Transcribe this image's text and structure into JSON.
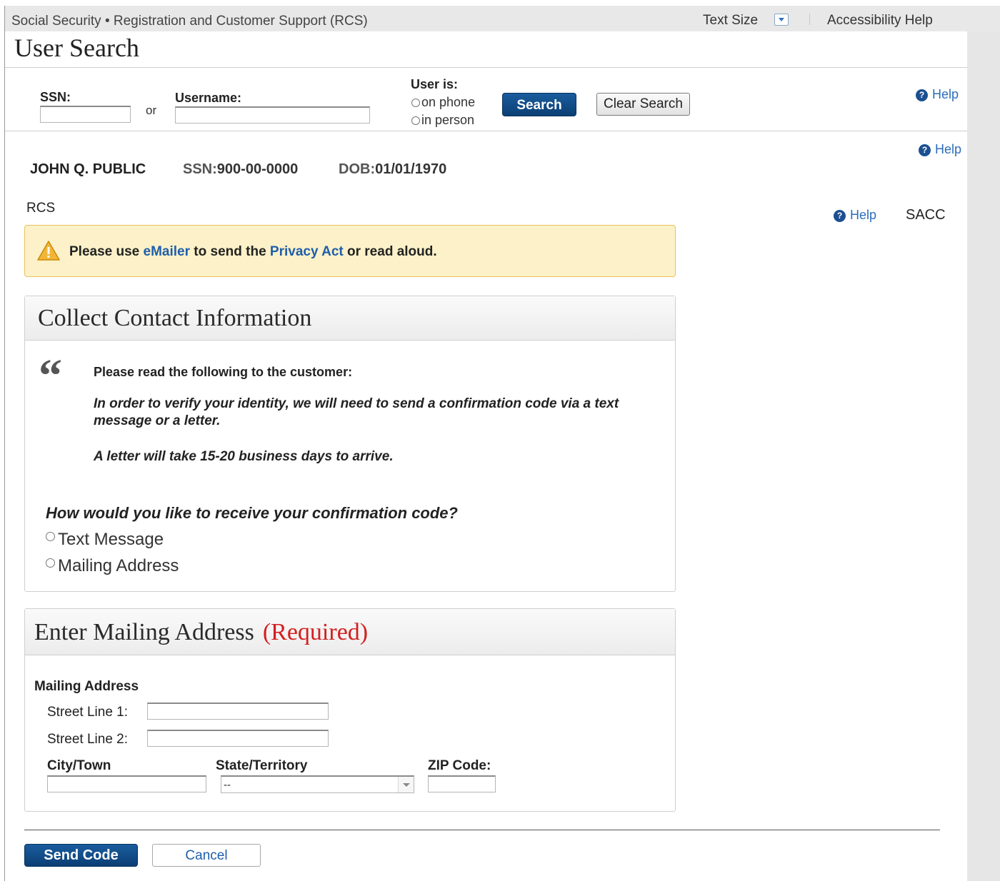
{
  "header": {
    "app_title": "Social Security • Registration and Customer Support (RCS)",
    "text_size": "Text Size",
    "accessibility_help": "Accessibility Help"
  },
  "page_title": "User Search",
  "search": {
    "ssn_label": "SSN:",
    "or_text": "or",
    "username_label": "Username:",
    "user_is_label": "User is:",
    "on_phone": "on phone",
    "in_person": "in person",
    "search_button": "Search",
    "clear_button": "Clear Search",
    "help": "Help"
  },
  "customer": {
    "name": "JOHN Q. PUBLIC",
    "ssn_label": "SSN:",
    "ssn": "900-00-0000",
    "dob_label": "DOB:",
    "dob": "01/01/1970",
    "help": "Help"
  },
  "context": {
    "rcs": "RCS",
    "help": "Help",
    "sacc": "SACC"
  },
  "alert": {
    "text_1": "Please use ",
    "link_1": "eMailer",
    "text_2": " to send the ",
    "link_2": "Privacy Act",
    "text_3": " or read aloud."
  },
  "contact_panel": {
    "title": "Collect Contact Information",
    "read_label": "Please read the following to the customer:",
    "script_1": "In order to verify your identity, we will need to send a confirmation code via a text message or a letter.",
    "script_2": "A letter will take 15-20 business days to arrive.",
    "question": "How would you like to receive your confirmation code?",
    "options": [
      "Text Message",
      "Mailing Address"
    ]
  },
  "address_panel": {
    "title": "Enter Mailing Address",
    "required": "(Required)",
    "section_label": "Mailing Address",
    "street1_label": "Street Line 1:",
    "street2_label": "Street Line 2:",
    "city_label": "City/Town",
    "state_label": "State/Territory",
    "state_value": "--",
    "zip_label": "ZIP Code:"
  },
  "actions": {
    "send_code": "Send Code",
    "cancel": "Cancel"
  }
}
